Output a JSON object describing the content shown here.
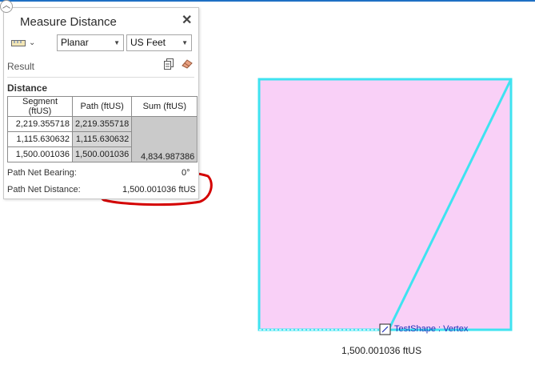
{
  "panel": {
    "title": "Measure Distance",
    "close_icon": "close-icon",
    "ruler_icon": "ruler-icon",
    "mode_select": "Planar",
    "unit_select": "US Feet",
    "result_label": "Result",
    "distance_label": "Distance",
    "table": {
      "headers": [
        "Segment (ftUS)",
        "Path (ftUS)",
        "Sum (ftUS)"
      ],
      "rows": [
        [
          "2,219.355718",
          "2,219.355718",
          ""
        ],
        [
          "1,115.630632",
          "1,115.630632",
          ""
        ],
        [
          "1,500.001036",
          "1,500.001036",
          "4,834.987386"
        ]
      ]
    },
    "net_bearing_label": "Path Net Bearing:",
    "net_bearing_value": "0°",
    "net_distance_label": "Path Net Distance:",
    "net_distance_value": "1,500.001036 ftUS"
  },
  "map": {
    "polygon_fill": "#f9d0f7",
    "measure_line_color": "#3fe3f0",
    "annotation_color": "#d40000",
    "snap_tip": "TestShape : Vertex",
    "distance_label": "1,500.001036 ftUS"
  }
}
